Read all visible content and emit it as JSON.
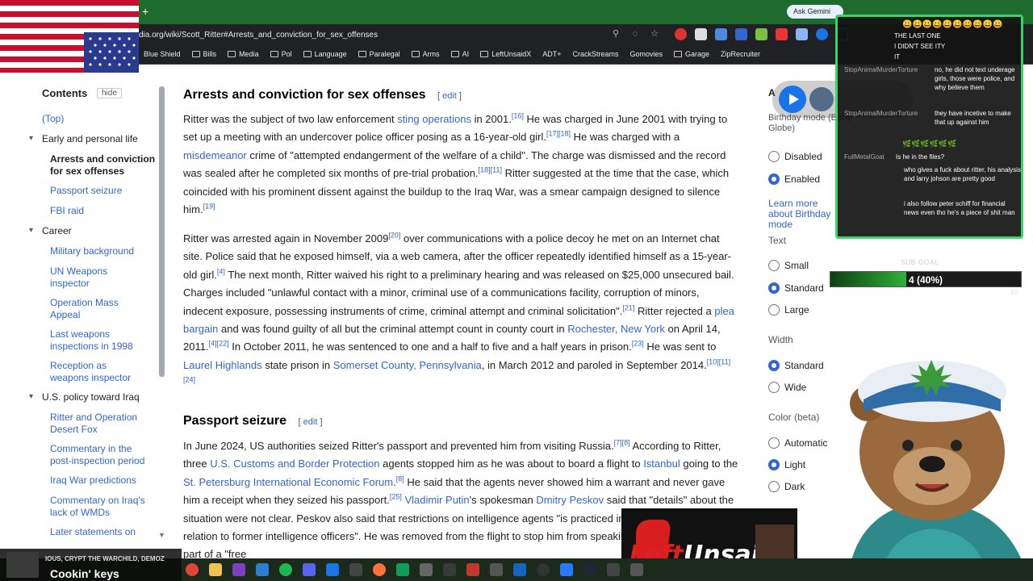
{
  "browser": {
    "url": "dia.org/wiki/Scott_Ritter#Arrests_and_conviction_for_sex_offenses",
    "new_tab": "+",
    "ask_gemini": "Ask Gemini",
    "bookmarks": [
      "Blue Shield",
      "Bills",
      "Media",
      "Pol",
      "Language",
      "Paralegal",
      "Arms",
      "AI",
      "LeftUnsaidX",
      "ADT+",
      "CrackStreams",
      "Gomovies",
      "Garage",
      "ZipRecruiter"
    ]
  },
  "toc": {
    "heading": "Contents",
    "hide": "hide",
    "items": [
      {
        "label": "(Top)"
      },
      {
        "label": "Early and personal life"
      },
      {
        "label": "Arrests and conviction for sex offenses"
      },
      {
        "label": "Passport seizure"
      },
      {
        "label": "FBI raid"
      },
      {
        "label": "Career"
      },
      {
        "label": "Military background"
      },
      {
        "label": "UN Weapons inspector"
      },
      {
        "label": "Operation Mass Appeal"
      },
      {
        "label": "Last weapons inspections in 1998"
      },
      {
        "label": "Reception as weapons inspector"
      },
      {
        "label": "U.S. policy toward Iraq"
      },
      {
        "label": "Ritter and Operation Desert Fox"
      },
      {
        "label": "Commentary in the post-inspection period"
      },
      {
        "label": "Iraq War predictions"
      },
      {
        "label": "Commentary on Iraq's lack of WMDs"
      },
      {
        "label": "Later statements on"
      }
    ]
  },
  "article": {
    "section1_title": "Arrests and conviction for sex offenses",
    "section2_title": "Passport seizure",
    "edit": "edit"
  },
  "appearance": {
    "title": "A",
    "birthday_mode": "Birthday mode (Baby Globe)",
    "disabled": "Disabled",
    "enabled": "Enabled",
    "learn_more": "Learn more about Birthday mode",
    "text_label": "Text",
    "small": "Small",
    "standard": "Standard",
    "large": "Large",
    "width_label": "Width",
    "width_standard": "Standard",
    "wide": "Wide",
    "color_label": "Color (beta)",
    "automatic": "Automatic",
    "light": "Light",
    "dark": "Dark"
  },
  "chat": {
    "lines": [
      {
        "name": "",
        "text": "THE LAST ONE"
      },
      {
        "name": "",
        "text": "I DIDN'T SEE ITY"
      },
      {
        "name": "",
        "text": "IT"
      },
      {
        "name": "StopAnimalMurderTorture",
        "text": "no, he did not text underage girls, those were police, and why believe them"
      },
      {
        "name": "StopAnimalMurderTorture",
        "text": "they have incetive to make that up against him"
      },
      {
        "name": "FullMetalGoat",
        "text": "Is he in the files?"
      },
      {
        "name": "",
        "text": "who gives a fuck about ritter, his analysis and larry johson are pretty good"
      },
      {
        "name": "",
        "text": "i also follow peter schiff for financial news even tho he's a piece of shit man"
      }
    ]
  },
  "sub_goal": {
    "title": "SUB GOAL",
    "text": "4 (40%)",
    "progress": 0.4,
    "end": "10",
    "color": "#2fb03b"
  },
  "stream": {
    "ticker": "IOUS, CRYPT THE WARCHILD, DEMOZ",
    "now_playing": "Cookin' keys",
    "logo_left": "Left",
    "logo_right": "Unsaid"
  }
}
